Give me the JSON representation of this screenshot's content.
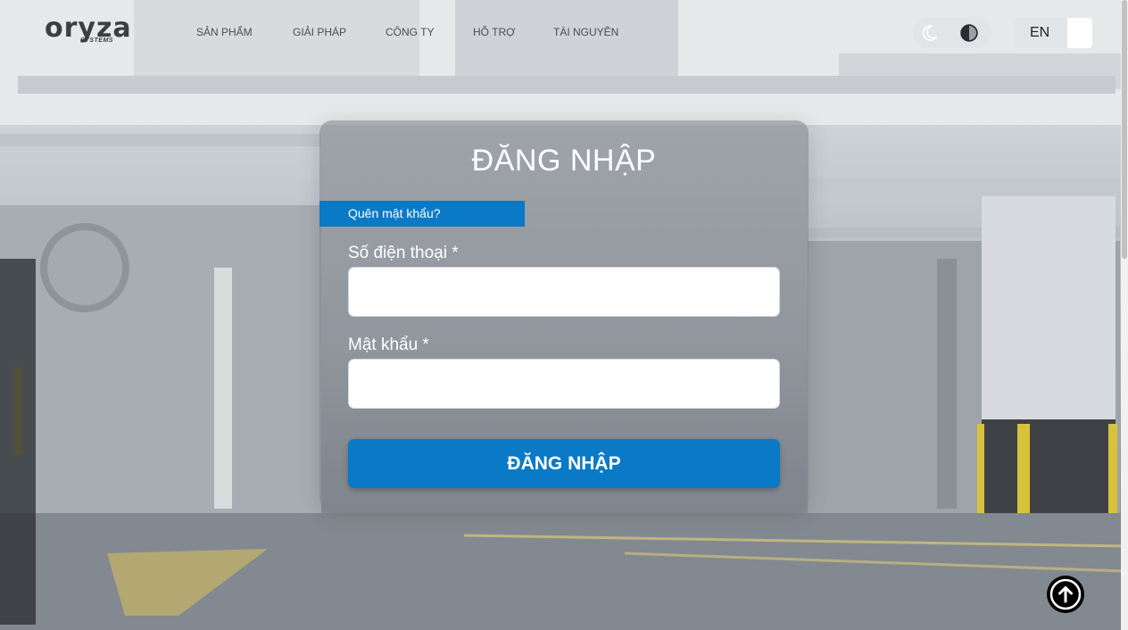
{
  "brand": {
    "logo_text": "oryza",
    "logo_subtext": "SYSTEMS"
  },
  "nav": {
    "items": [
      {
        "label": "SẢN PHẨM"
      },
      {
        "label": "GIẢI PHÁP"
      },
      {
        "label": "CÔNG TY"
      },
      {
        "label": "HỖ TRỢ"
      },
      {
        "label": "TÀI NGUYÊN"
      }
    ]
  },
  "language": {
    "label": "EN"
  },
  "login": {
    "title": "ĐĂNG NHẬP",
    "forgot_password": "Quên mật khẩu?",
    "phone_label": "Số điện thoại *",
    "phone_value": "",
    "password_label": "Mật khẩu *",
    "password_value": "",
    "submit_label": "ĐĂNG NHẬP"
  },
  "colors": {
    "primary": "#0a7ac7",
    "card_overlay": "#787e85"
  },
  "icons": {
    "theme_light": "moon-icon",
    "theme_contrast": "contrast-icon",
    "scroll_top": "arrow-up-circle-icon"
  }
}
